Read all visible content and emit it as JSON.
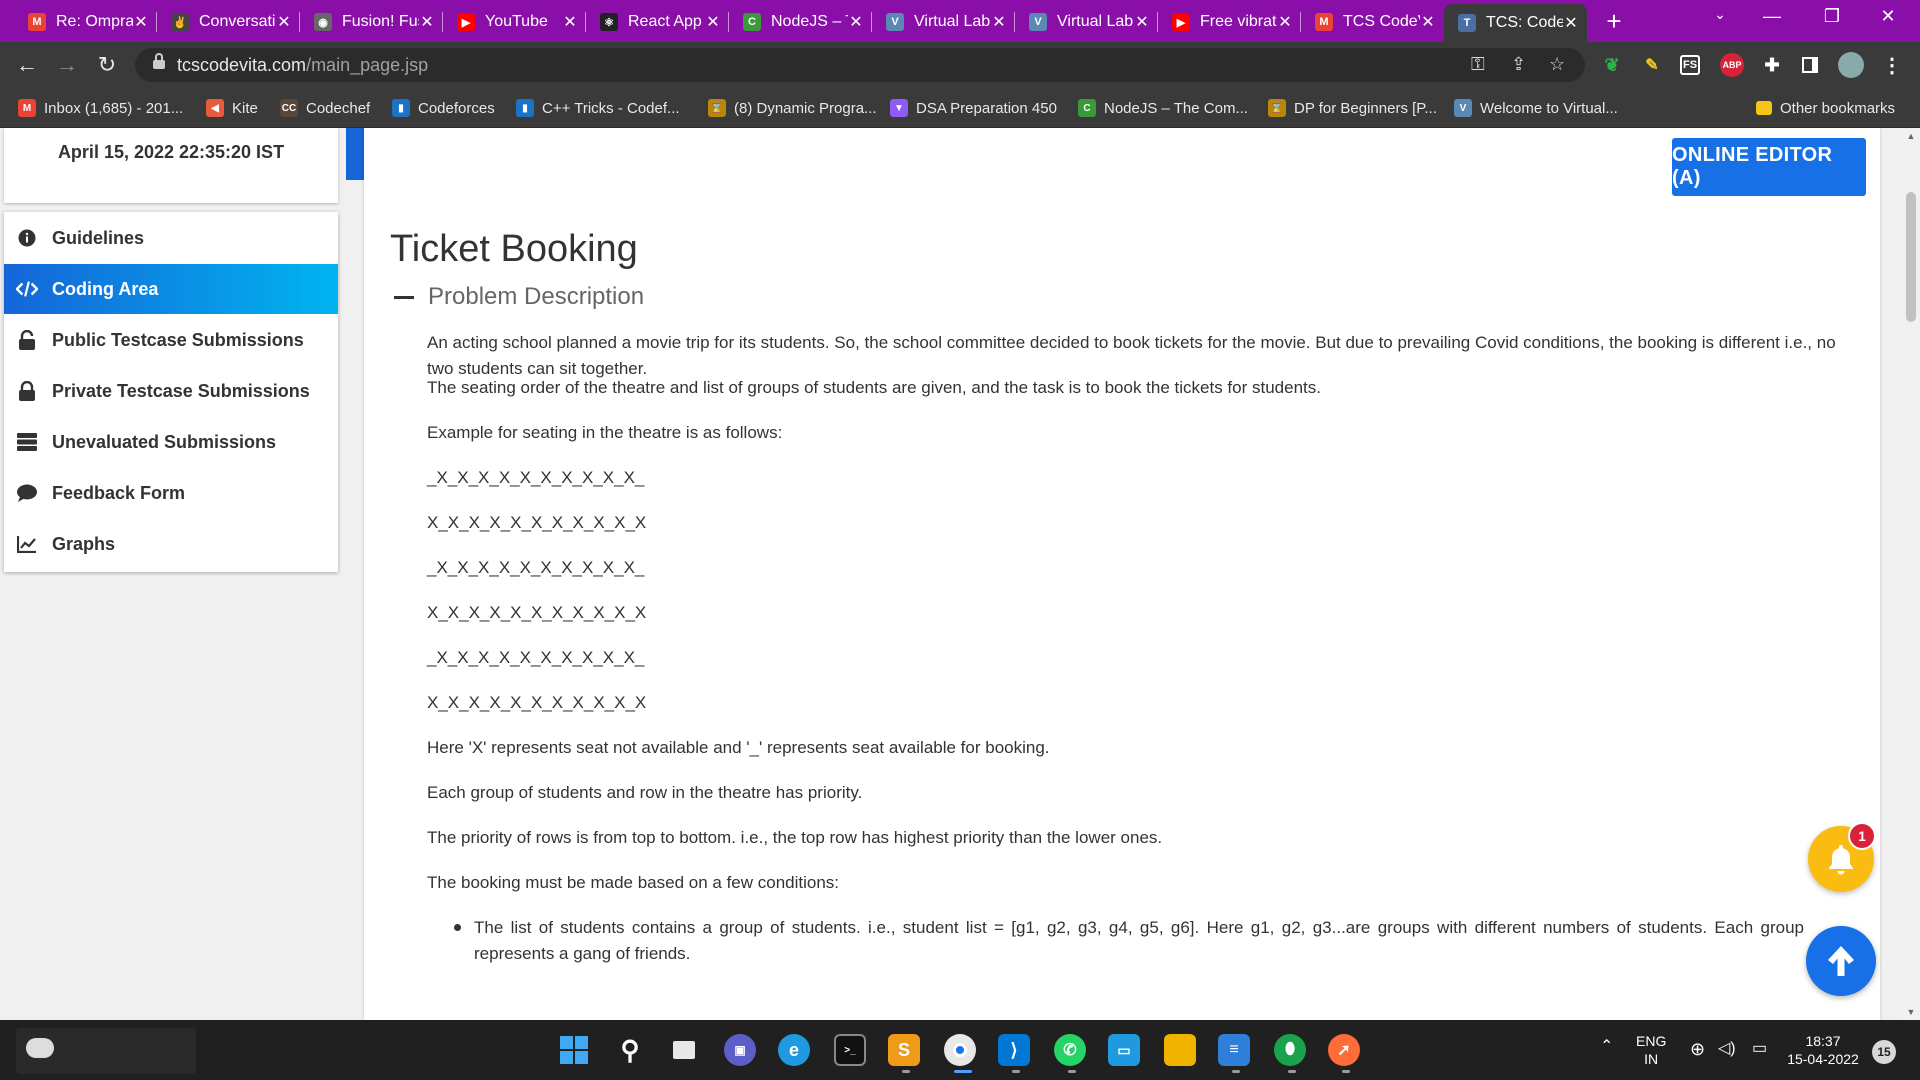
{
  "browser": {
    "tabs": [
      {
        "title": "Re: Omprakash",
        "favicon": "gmail-icon",
        "color": "#ea4335",
        "glyph": "M"
      },
      {
        "title": "Conversations",
        "favicon": "peace-hand-icon",
        "color": "#444444",
        "glyph": "✌"
      },
      {
        "title": "Fusion! Fusion",
        "favicon": "globe-icon",
        "color": "#666666",
        "glyph": "◉"
      },
      {
        "title": "YouTube",
        "favicon": "youtube-icon",
        "color": "#ff0000",
        "glyph": "▶"
      },
      {
        "title": "React App",
        "favicon": "react-icon",
        "color": "#222222",
        "glyph": "⚛"
      },
      {
        "title": "NodeJS – The",
        "favicon": "codegrepper-icon",
        "color": "#3a9a3a",
        "glyph": "C"
      },
      {
        "title": "Virtual Lab",
        "favicon": "virtual-lab-icon",
        "color": "#5a8ab4",
        "glyph": "V"
      },
      {
        "title": "Virtual Lab",
        "favicon": "virtual-lab-icon",
        "color": "#5a8ab4",
        "glyph": "V"
      },
      {
        "title": "Free vibrato",
        "favicon": "youtube-icon",
        "color": "#ff0000",
        "glyph": "▶"
      },
      {
        "title": "TCS CodeVita",
        "favicon": "gmail-icon",
        "color": "#ea4335",
        "glyph": "M"
      },
      {
        "title": "TCS: CodeVita",
        "favicon": "tcs-icon",
        "color": "#4a6fa5",
        "glyph": "T"
      }
    ],
    "url_host": "tcscodevita.com",
    "url_path": "/main_page.jsp",
    "bookmarks": [
      {
        "label": "Inbox (1,685) - 201...",
        "icon": "gmail-icon",
        "color": "#ea4335",
        "glyph": "M"
      },
      {
        "label": "Kite",
        "icon": "kite-icon",
        "color": "#e85a3c",
        "glyph": "◀"
      },
      {
        "label": "Codechef",
        "icon": "codechef-icon",
        "color": "#5b4638",
        "glyph": "CC"
      },
      {
        "label": "Codeforces",
        "icon": "codeforces-icon",
        "color": "#1a73c7",
        "glyph": "▮"
      },
      {
        "label": "C++ Tricks - Codef...",
        "icon": "codeforces-icon",
        "color": "#1a73c7",
        "glyph": "▮"
      },
      {
        "label": "(8) Dynamic Progra...",
        "icon": "hourglass-icon",
        "color": "#b8860b",
        "glyph": "⌛"
      },
      {
        "label": "DSA Preparation 450",
        "icon": "vite-icon",
        "color": "#8b5cf6",
        "glyph": "▼"
      },
      {
        "label": "NodeJS – The Com...",
        "icon": "codegrepper-icon",
        "color": "#3a9a3a",
        "glyph": "C"
      },
      {
        "label": "DP for Beginners [P...",
        "icon": "hourglass-icon",
        "color": "#b8860b",
        "glyph": "⌛"
      },
      {
        "label": "Welcome to Virtual...",
        "icon": "virtual-lab-icon",
        "color": "#5a8ab4",
        "glyph": "V"
      }
    ],
    "other_bookmarks": "Other bookmarks"
  },
  "sidebar": {
    "datetime": "April 15, 2022 22:35:20 IST",
    "items": [
      {
        "label": "Guidelines",
        "icon": "info-icon"
      },
      {
        "label": "Coding Area",
        "icon": "code-icon"
      },
      {
        "label": "Public Testcase Submissions",
        "icon": "lock-open-icon"
      },
      {
        "label": "Private Testcase Submissions",
        "icon": "lock-icon"
      },
      {
        "label": "Unevaluated Submissions",
        "icon": "server-icon"
      },
      {
        "label": "Feedback Form",
        "icon": "comment-icon"
      },
      {
        "label": "Graphs",
        "icon": "chart-icon"
      }
    ],
    "active_index": 1
  },
  "main": {
    "editor_button": "ONLINE EDITOR (A)",
    "title": "Ticket Booking",
    "section": "Problem Description",
    "paragraphs": [
      "An acting school planned a movie trip for its students. So, the school committee decided to book tickets for the movie. But due to prevailing Covid conditions, the booking is different i.e., no two students can sit together.",
      "The seating order of the theatre and list of groups of students are given, and the task is to book the tickets for students.",
      "Example for seating in the theatre is as follows:",
      "_X_X_X_X_X_X_X_X_X_X_",
      "X_X_X_X_X_X_X_X_X_X_X",
      "_X_X_X_X_X_X_X_X_X_X_",
      "X_X_X_X_X_X_X_X_X_X_X",
      "_X_X_X_X_X_X_X_X_X_X_",
      "X_X_X_X_X_X_X_X_X_X_X",
      "Here 'X' represents seat not available and '_' represents seat available for booking.",
      "Each group of students and row in the theatre has priority.",
      "The priority of rows is from top to bottom. i.e., the top row has highest priority than the lower ones.",
      "The booking must be made based on a few conditions:"
    ],
    "bullets": [
      "The list of students contains a group of students. i.e., student list = [g1, g2, g3, g4, g5, g6]. Here g1, g2, g3...are groups with different numbers of students. Each group represents a gang of friends."
    ]
  },
  "floating": {
    "notification_count": "1"
  },
  "taskbar": {
    "lang": "ENG",
    "region": "IN",
    "time": "18:37",
    "date": "15-04-2022",
    "notif_badge": "15"
  }
}
